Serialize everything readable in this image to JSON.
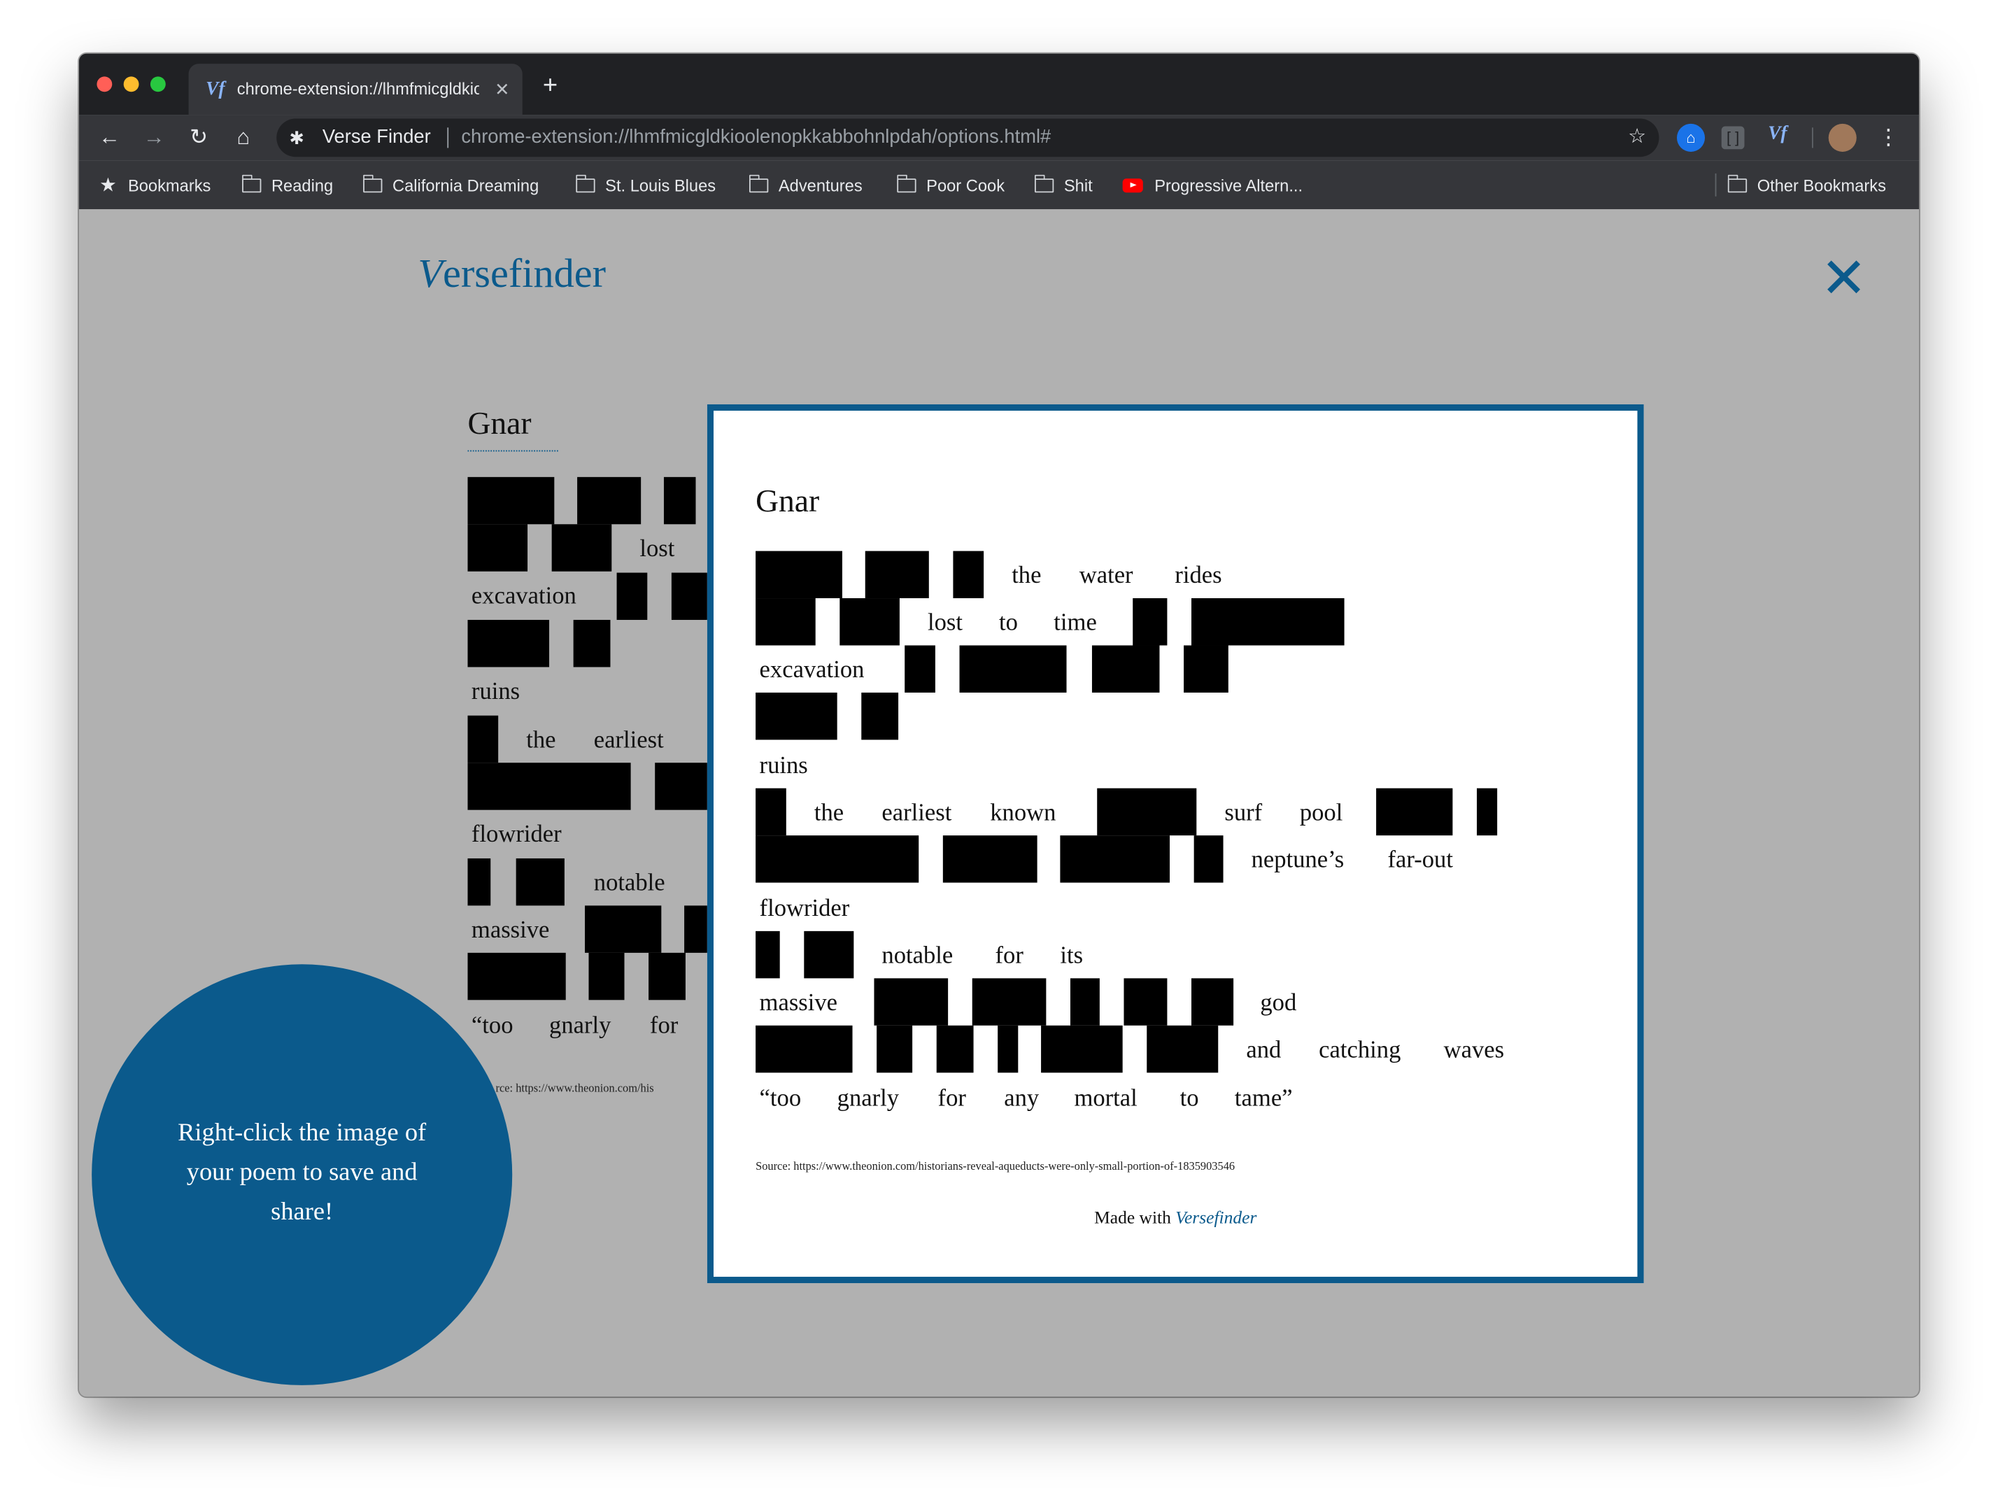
{
  "browser": {
    "tab_title": "chrome-extension://lhmfmicgldkioolenopkkabbohnlpdah/options.html#",
    "tab_favicon": "Vf",
    "site_name": "Verse Finder",
    "url": "chrome-extension://lhmfmicgldkioolenopkkabbohnlpdah/options.html#",
    "bookmarks": [
      "Bookmarks",
      "Reading",
      "California Dreaming",
      "St. Louis Blues",
      "Adventures",
      "Poor Cook",
      "Shit",
      "Progressive Altern..."
    ],
    "other_bookmarks": "Other Bookmarks",
    "icons": {
      "back": "arrow-left-icon",
      "forward": "arrow-right-icon",
      "reload": "reload-icon",
      "home": "home-icon",
      "extension": "puzzle-icon",
      "bookmark_star": "star-icon",
      "menu": "more-vert-icon"
    }
  },
  "app": {
    "logo_v": "V",
    "logo_rest": "ersefinder",
    "close_icon": "close-icon",
    "accent_color": "#0b5a8c"
  },
  "background_poem": {
    "title": "Gnar",
    "visible_words": [
      "lost",
      "excavation",
      "ruins",
      "the",
      "earliest",
      "flowrider",
      "notable",
      "massive",
      "“too",
      "gnarly",
      "for"
    ],
    "source_fragment": "rce: https://www.theonion.com/his"
  },
  "poem_card": {
    "title": "Gnar",
    "lines": [
      [
        "the",
        "water",
        "rides"
      ],
      [
        "lost",
        "to",
        "time"
      ],
      [
        "excavation"
      ],
      [],
      [
        "ruins"
      ],
      [
        "the",
        "earliest",
        "known",
        "surf",
        "pool"
      ],
      [
        "neptune’s",
        "far-out"
      ],
      [
        "flowrider"
      ],
      [
        "notable",
        "for",
        "its"
      ],
      [
        "massive",
        "god"
      ],
      [
        "and",
        "catching",
        "waves"
      ],
      [
        "“too",
        "gnarly",
        "for",
        "any",
        "mortal",
        "to",
        "tame”"
      ]
    ],
    "source_label": "Source:",
    "source_url": "https://www.theonion.com/historians-reveal-aqueducts-were-only-small-portion-of-1835903546",
    "made_with": "Made with",
    "made_with_link": "Versefinder"
  },
  "tooltip_circle": {
    "text": "Right-click the image of your poem to save and share!"
  }
}
